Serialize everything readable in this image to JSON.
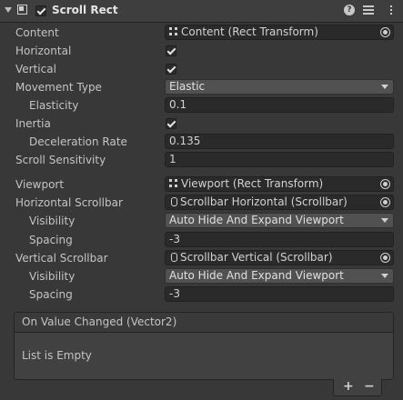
{
  "header": {
    "title": "Scroll Rect",
    "enabled": true,
    "help_glyph": "?"
  },
  "properties": {
    "content": {
      "label": "Content",
      "value": "Content (Rect Transform)"
    },
    "horizontal": {
      "label": "Horizontal",
      "checked": true
    },
    "vertical": {
      "label": "Vertical",
      "checked": true
    },
    "movement_type": {
      "label": "Movement Type",
      "value": "Elastic"
    },
    "elasticity": {
      "label": "Elasticity",
      "value": "0.1"
    },
    "inertia": {
      "label": "Inertia",
      "checked": true
    },
    "deceleration_rate": {
      "label": "Deceleration Rate",
      "value": "0.135"
    },
    "scroll_sensitivity": {
      "label": "Scroll Sensitivity",
      "value": "1"
    },
    "viewport": {
      "label": "Viewport",
      "value": "Viewport (Rect Transform)"
    },
    "horizontal_scrollbar": {
      "label": "Horizontal Scrollbar",
      "value": "Scrollbar Horizontal (Scrollbar)"
    },
    "h_visibility": {
      "label": "Visibility",
      "value": "Auto Hide And Expand Viewport"
    },
    "h_spacing": {
      "label": "Spacing",
      "value": "-3"
    },
    "vertical_scrollbar": {
      "label": "Vertical Scrollbar",
      "value": "Scrollbar Vertical (Scrollbar)"
    },
    "v_visibility": {
      "label": "Visibility",
      "value": "Auto Hide And Expand Viewport"
    },
    "v_spacing": {
      "label": "Spacing",
      "value": "-3"
    }
  },
  "event": {
    "title": "On Value Changed (Vector2)",
    "empty_text": "List is Empty",
    "add_glyph": "+",
    "remove_glyph": "−"
  }
}
